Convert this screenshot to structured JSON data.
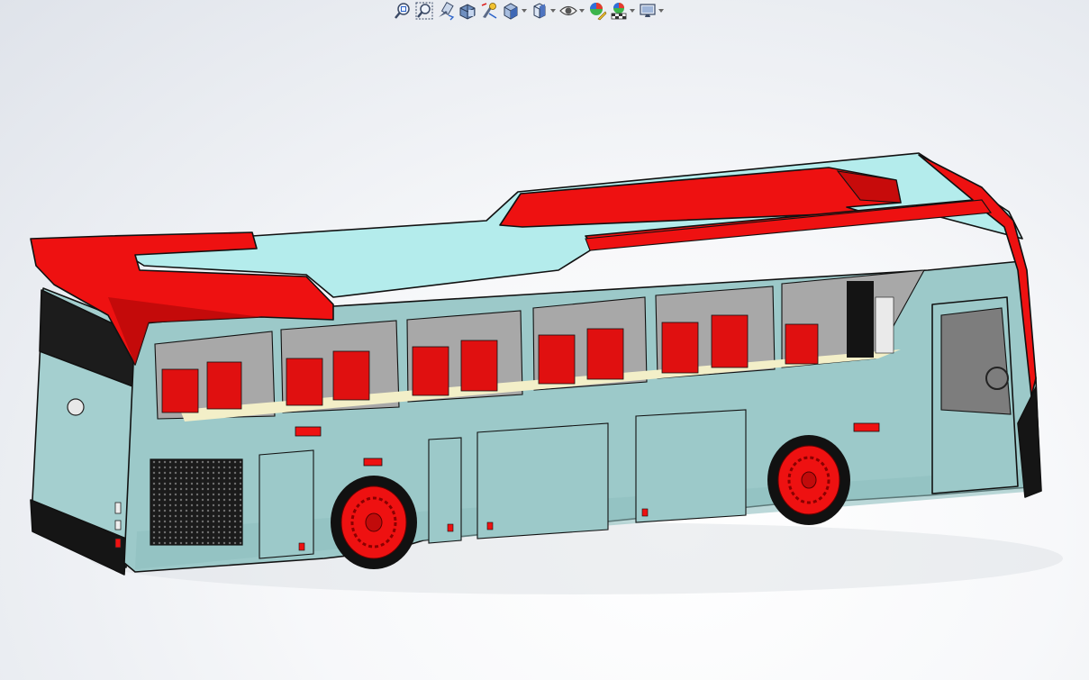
{
  "toolbar": {
    "items": [
      {
        "icon": "zoom-to-fit-icon",
        "caret": false
      },
      {
        "icon": "zoom-to-area-icon",
        "caret": false
      },
      {
        "icon": "previous-view-icon",
        "caret": false
      },
      {
        "icon": "section-view-icon",
        "caret": false
      },
      {
        "icon": "dynamic-annotation-views-icon",
        "caret": false
      },
      {
        "icon": "view-orientation-icon",
        "caret": true
      },
      {
        "icon": "display-style-icon",
        "caret": true
      },
      {
        "icon": "hide-show-items-icon",
        "caret": true
      },
      {
        "icon": "edit-appearance-icon",
        "caret": false
      },
      {
        "icon": "apply-scene-icon",
        "caret": true
      },
      {
        "icon": "view-settings-icon",
        "caret": true
      }
    ]
  },
  "model": {
    "name": "bus-3d-model",
    "colors": {
      "body": "#9cc9c9",
      "body_top": "#b4ecec",
      "accent": "#ee1111",
      "accent_dark": "#b50808",
      "interior": "#a8a8a8",
      "floor": "#f3efc8",
      "tire": "#111111",
      "grille": "#1b1b1b",
      "outline": "#111111"
    }
  }
}
